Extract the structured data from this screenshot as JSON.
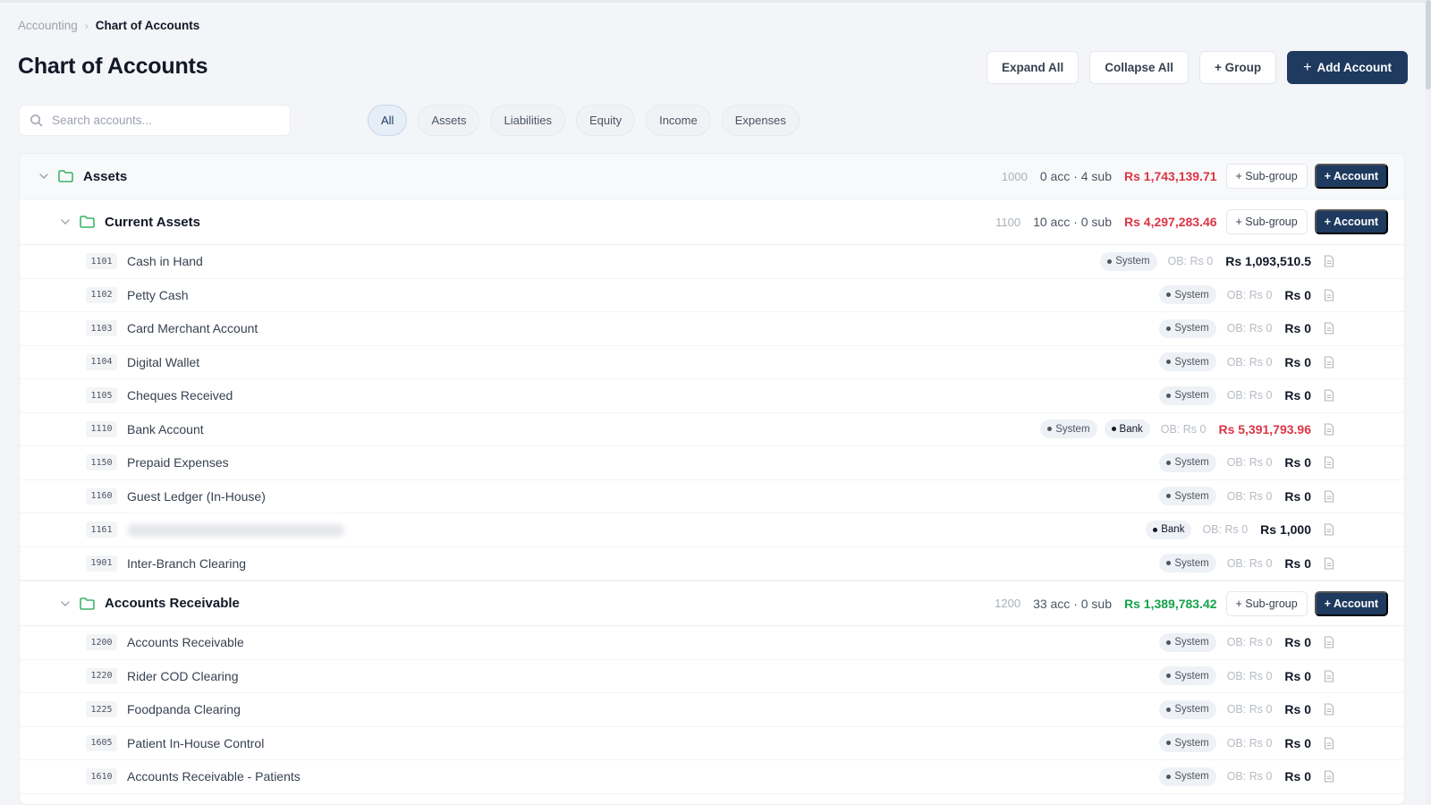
{
  "breadcrumb": {
    "parent": "Accounting",
    "separator": "›",
    "current": "Chart of Accounts"
  },
  "page": {
    "title": "Chart of Accounts"
  },
  "actions": {
    "expand_all": "Expand All",
    "collapse_all": "Collapse All",
    "group": "+ Group",
    "add_account": "Add Account",
    "add_icon": "+"
  },
  "search": {
    "placeholder": "Search accounts...",
    "value": ""
  },
  "filters": {
    "all": "All",
    "assets": "Assets",
    "liabilities": "Liabilities",
    "equity": "Equity",
    "income": "Income",
    "expenses": "Expenses",
    "active": "All"
  },
  "colors": {
    "primary": "#1e3a5f",
    "negative": "#dc3545",
    "positive": "#16a34a",
    "folder": "#16a34a"
  },
  "icons": {
    "search": "search-icon",
    "folder": "folder-icon",
    "chevron": "chevron-down-icon",
    "document": "document-icon"
  },
  "common": {
    "sub_group_button": "+ Sub-group",
    "account_button": "+ Account",
    "system_tag": "System",
    "bank_tag": "Bank"
  },
  "groups": {
    "assets": {
      "name": "Assets",
      "code": "1000",
      "counts": "0 acc · 4 sub",
      "total": "Rs 1,743,139.71"
    },
    "current_assets": {
      "name": "Current Assets",
      "code": "1100",
      "counts": "10 acc · 0 sub",
      "total": "Rs 4,297,283.46",
      "accounts": [
        {
          "code": "1101",
          "name": "Cash in Hand",
          "ob": "OB: Rs 0",
          "balance": "Rs 1,093,510.5"
        },
        {
          "code": "1102",
          "name": "Petty Cash",
          "ob": "OB: Rs 0",
          "balance": "Rs 0"
        },
        {
          "code": "1103",
          "name": "Card Merchant Account",
          "ob": "OB: Rs 0",
          "balance": "Rs 0"
        },
        {
          "code": "1104",
          "name": "Digital Wallet",
          "ob": "OB: Rs 0",
          "balance": "Rs 0"
        },
        {
          "code": "1105",
          "name": "Cheques Received",
          "ob": "OB: Rs 0",
          "balance": "Rs 0"
        },
        {
          "code": "1110",
          "name": "Bank Account",
          "ob": "OB: Rs 0",
          "balance": "Rs 5,391,793.96"
        },
        {
          "code": "1150",
          "name": "Prepaid Expenses",
          "ob": "OB: Rs 0",
          "balance": "Rs 0"
        },
        {
          "code": "1160",
          "name": "Guest Ledger (In-House)",
          "ob": "OB: Rs 0",
          "balance": "Rs 0"
        },
        {
          "code": "1161",
          "ob": "OB: Rs 0",
          "balance": "Rs 1,000"
        },
        {
          "code": "1901",
          "name": "Inter-Branch Clearing",
          "ob": "OB: Rs 0",
          "balance": "Rs 0"
        }
      ]
    },
    "accounts_receivable": {
      "name": "Accounts Receivable",
      "code": "1200",
      "counts": "33 acc · 0 sub",
      "total": "Rs 1,389,783.42",
      "accounts": [
        {
          "code": "1200",
          "name": "Accounts Receivable",
          "ob": "OB: Rs 0",
          "balance": "Rs 0"
        },
        {
          "code": "1220",
          "name": "Rider COD Clearing",
          "ob": "OB: Rs 0",
          "balance": "Rs 0"
        },
        {
          "code": "1225",
          "name": "Foodpanda Clearing",
          "ob": "OB: Rs 0",
          "balance": "Rs 0"
        },
        {
          "code": "1605",
          "name": "Patient In-House Control",
          "ob": "OB: Rs 0",
          "balance": "Rs 0"
        },
        {
          "code": "1610",
          "name": "Accounts Receivable - Patients",
          "ob": "OB: Rs 0",
          "balance": "Rs 0"
        }
      ]
    }
  }
}
